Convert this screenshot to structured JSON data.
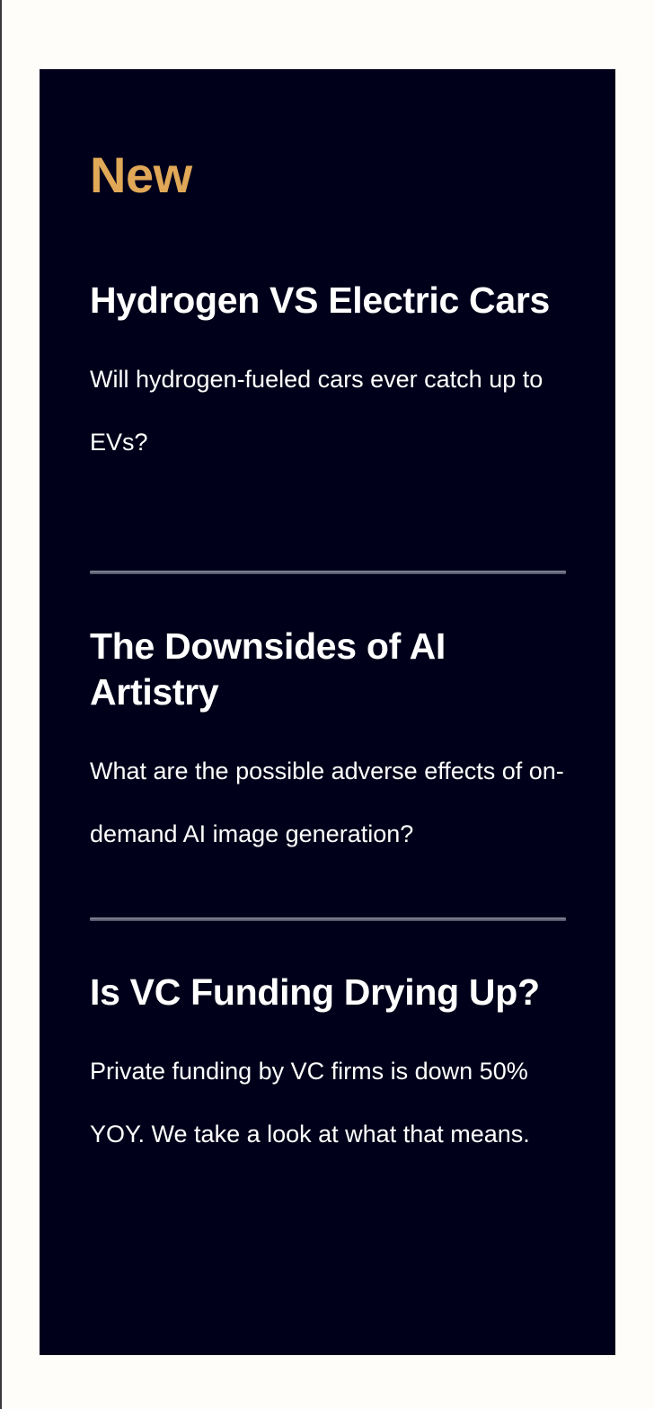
{
  "panel": {
    "heading": "New"
  },
  "articles": [
    {
      "title": "Hydrogen VS Electric Cars",
      "description": "Will hydrogen-fueled cars ever catch up to EVs?"
    },
    {
      "title": "The Downsides of AI Artistry",
      "description": "What are the possible adverse effects of on-demand AI image generation?"
    },
    {
      "title": "Is VC Funding Drying Up?",
      "description": "Private funding by VC firms is down 50% YOY. We take a look at what that means."
    }
  ],
  "colors": {
    "page_background": "#fffdfa",
    "panel_background": "#00001a",
    "heading_accent": "#e0a857",
    "text": "#ffffff",
    "divider": "#6b6d80"
  }
}
